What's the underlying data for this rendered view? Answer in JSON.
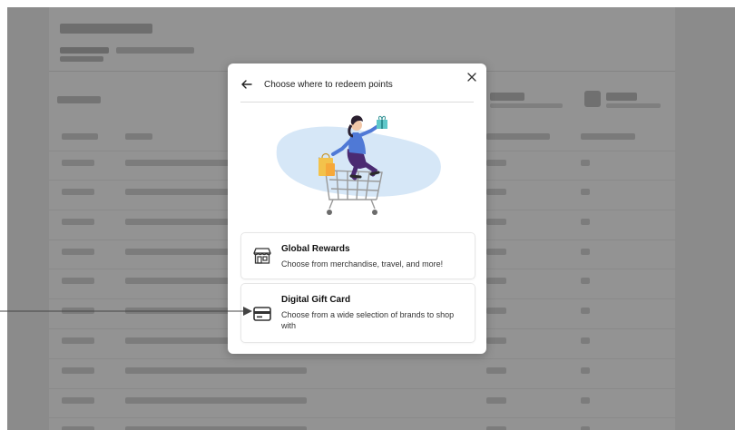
{
  "modal": {
    "title": "Choose where to redeem points",
    "options": [
      {
        "title": "Global Rewards",
        "description": "Choose from merchandise, travel, and more!",
        "icon": "storefront-icon"
      },
      {
        "title": "Digital Gift Card",
        "description": "Choose from a wide selection of brands to shop with",
        "icon": "credit-card-icon"
      }
    ]
  },
  "colors": {
    "overlay": "#8b8b8b",
    "illustration_blob": "#d6e7f7",
    "figure_top": "#4f79d6",
    "figure_pants": "#4a2a72",
    "bag": "#f3c24b",
    "gift": "#5ec7c9"
  }
}
